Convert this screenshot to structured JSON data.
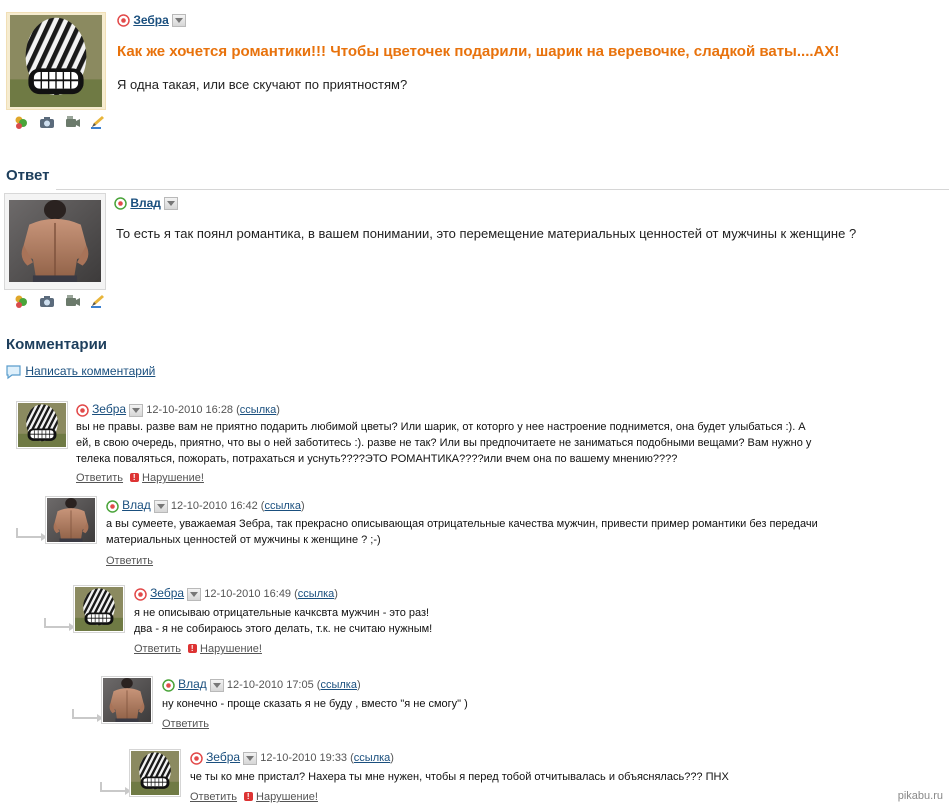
{
  "question": {
    "author": "Зебра",
    "title": "Как же хочется романтики!!! Чтобы цветочек подарили, шарик на веревочке, сладкой ваты....АХ!",
    "body": "Я одна такая, или все скучают по приятностям?"
  },
  "answer_section": {
    "title": "Ответ",
    "author": "Влад",
    "body": "То есть я так поянл романтика, в вашем понимании, это перемещение материальных ценностей от мужчины к женщине ?"
  },
  "comments_section": {
    "title": "Комментарии",
    "write_comment": "Написать комментарий"
  },
  "labels": {
    "reply": "Ответить",
    "violation": "Нарушение!",
    "link": "ссылка"
  },
  "comments": [
    {
      "author": "Зебра",
      "date": "12-10-2010 16:28",
      "lines": [
        "вы не правы. разве вам не приятно подарить любимой цветы? Или шарик, от которго у нее настроение поднимется, она будет улыбаться :). А",
        "ей, в свою очередь, приятно, что вы о ней заботитесь :). разве не так? Или вы предпочитаете не заниматься подобными вещами? Вам нужно у",
        "телека поваляться, пожорать, потрахаться и уснуть????ЭТО РОМАНТИКА????или вчем она по вашему мнению????"
      ]
    },
    {
      "author": "Влад",
      "date": "12-10-2010 16:42",
      "lines": [
        "а вы сумеете, уважаемая Зебра, так прекрасно описывающая отрицательные качества мужчин, привести пример романтики без передачи",
        "материальных ценностей от мужчины к женщине ? ;-)"
      ]
    },
    {
      "author": "Зебра",
      "date": "12-10-2010 16:49",
      "lines": [
        "я не описываю отрицательные качксвта мужчин - это раз!",
        "два - я не собираюсь этого делать, т.к. не считаю нужным!"
      ]
    },
    {
      "author": "Влад",
      "date": "12-10-2010 17:05",
      "lines": [
        "ну конечно - проще сказать я не буду , вместо \"я не смогу\" )"
      ]
    },
    {
      "author": "Зебра",
      "date": "12-10-2010 19:33",
      "lines": [
        "че ты ко мне пристал? Нахера ты мне нужен, чтобы я перед тобой отчитывалась и объяснялась??? ПНХ"
      ]
    }
  ],
  "watermark": "pikabu.ru",
  "colors": {
    "question_title": "#e8720c",
    "link": "#1a4f7e",
    "section_title": "#1d3e5c",
    "zebra_badge": "#e24a4a",
    "vlad_badge": "#4aa43a"
  }
}
